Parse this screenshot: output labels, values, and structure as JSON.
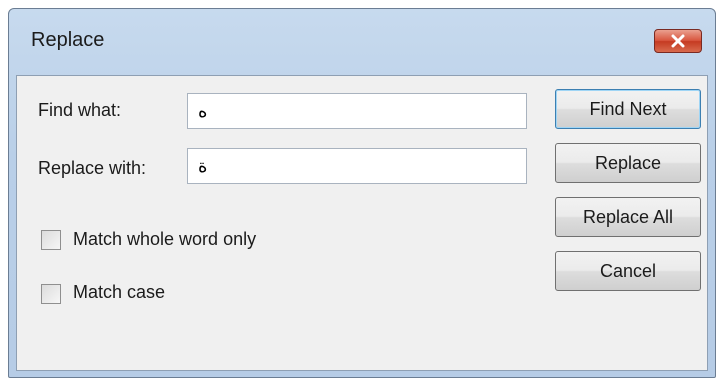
{
  "window": {
    "title": "Replace"
  },
  "find": {
    "label": "Find what:",
    "value": "ه"
  },
  "replace": {
    "label": "Replace with:",
    "value": "ة"
  },
  "options": {
    "whole_word": {
      "label": "Match whole word only",
      "checked": false
    },
    "match_case": {
      "label": "Match case",
      "checked": false
    }
  },
  "buttons": {
    "find_next": "Find Next",
    "replace": "Replace",
    "replace_all": "Replace All",
    "cancel": "Cancel"
  },
  "icons": {
    "close": "close-icon"
  },
  "colors": {
    "frame": "#b9cfe8",
    "close_button": "#d8553e",
    "client_bg": "#f0f0f0"
  }
}
